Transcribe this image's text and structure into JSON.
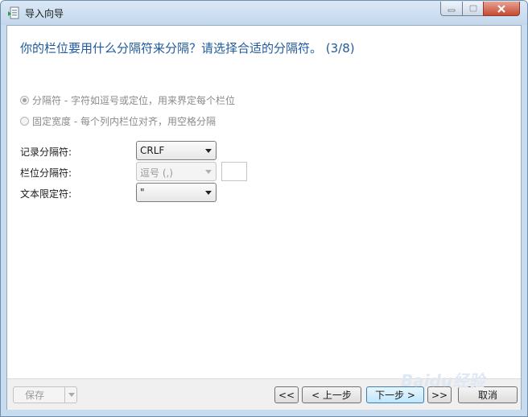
{
  "window": {
    "title": "导入向导",
    "icon": "import-wizard-icon"
  },
  "heading": "你的栏位要用什么分隔符来分隔？请选择合适的分隔符。 (3/8)",
  "options": [
    {
      "label": "分隔符 - 字符如逗号或定位，用来界定每个栏位",
      "selected": true,
      "disabled": true
    },
    {
      "label": "固定宽度 - 每个列内栏位对齐，用空格分隔",
      "selected": false,
      "disabled": true
    }
  ],
  "fields": {
    "record_delimiter": {
      "label": "记录分隔符:",
      "value": "CRLF"
    },
    "field_delimiter": {
      "label": "栏位分隔符:",
      "value": "逗号 (,)",
      "custom_value": ""
    },
    "text_qualifier": {
      "label": "文本限定符:",
      "value": "\""
    }
  },
  "footer": {
    "save_label": "保存",
    "first_label": "<<",
    "prev_label": "< 上一步",
    "next_label": "下一步 >",
    "last_label": ">>",
    "cancel_label": "取消"
  },
  "watermark": "Baidu经验",
  "colors": {
    "heading": "#1f5a9e",
    "titlebar": "#c3d7ec",
    "close_button": "#c64a33"
  }
}
